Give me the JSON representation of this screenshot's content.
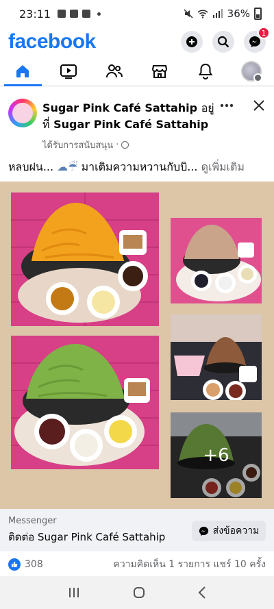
{
  "status_bar": {
    "time": "23:11",
    "battery": "36%"
  },
  "header": {
    "logo": "facebook",
    "messenger_badge": "1"
  },
  "tabs": [
    "home",
    "video",
    "friends",
    "marketplace",
    "notifications",
    "profile"
  ],
  "post": {
    "page_name": "Sugar Pink Café Sattahip",
    "title_connector_1": "อยู่",
    "title_connector_2": "ที่",
    "location_name": "Sugar Pink Café Sattahip",
    "sponsored_label": "ได้รับการสนับสนุน",
    "text_prefix": "หลบฝน...",
    "text_body": " มาเติมความหวานกับบิ...",
    "see_more": "ดูเพิ่มเติม",
    "more_photos": "+6"
  },
  "cta": {
    "label": "Messenger",
    "title": "ติดต่อ Sugar Pink Café Sattahip",
    "button": "ส่งข้อความ"
  },
  "stats": {
    "likes": "308",
    "comments_shares": "ความคิดเห็น 1 รายการ  แชร์ 10 ครั้ง"
  },
  "colors": {
    "brand": "#1877f2",
    "badge": "#e41e3f"
  }
}
